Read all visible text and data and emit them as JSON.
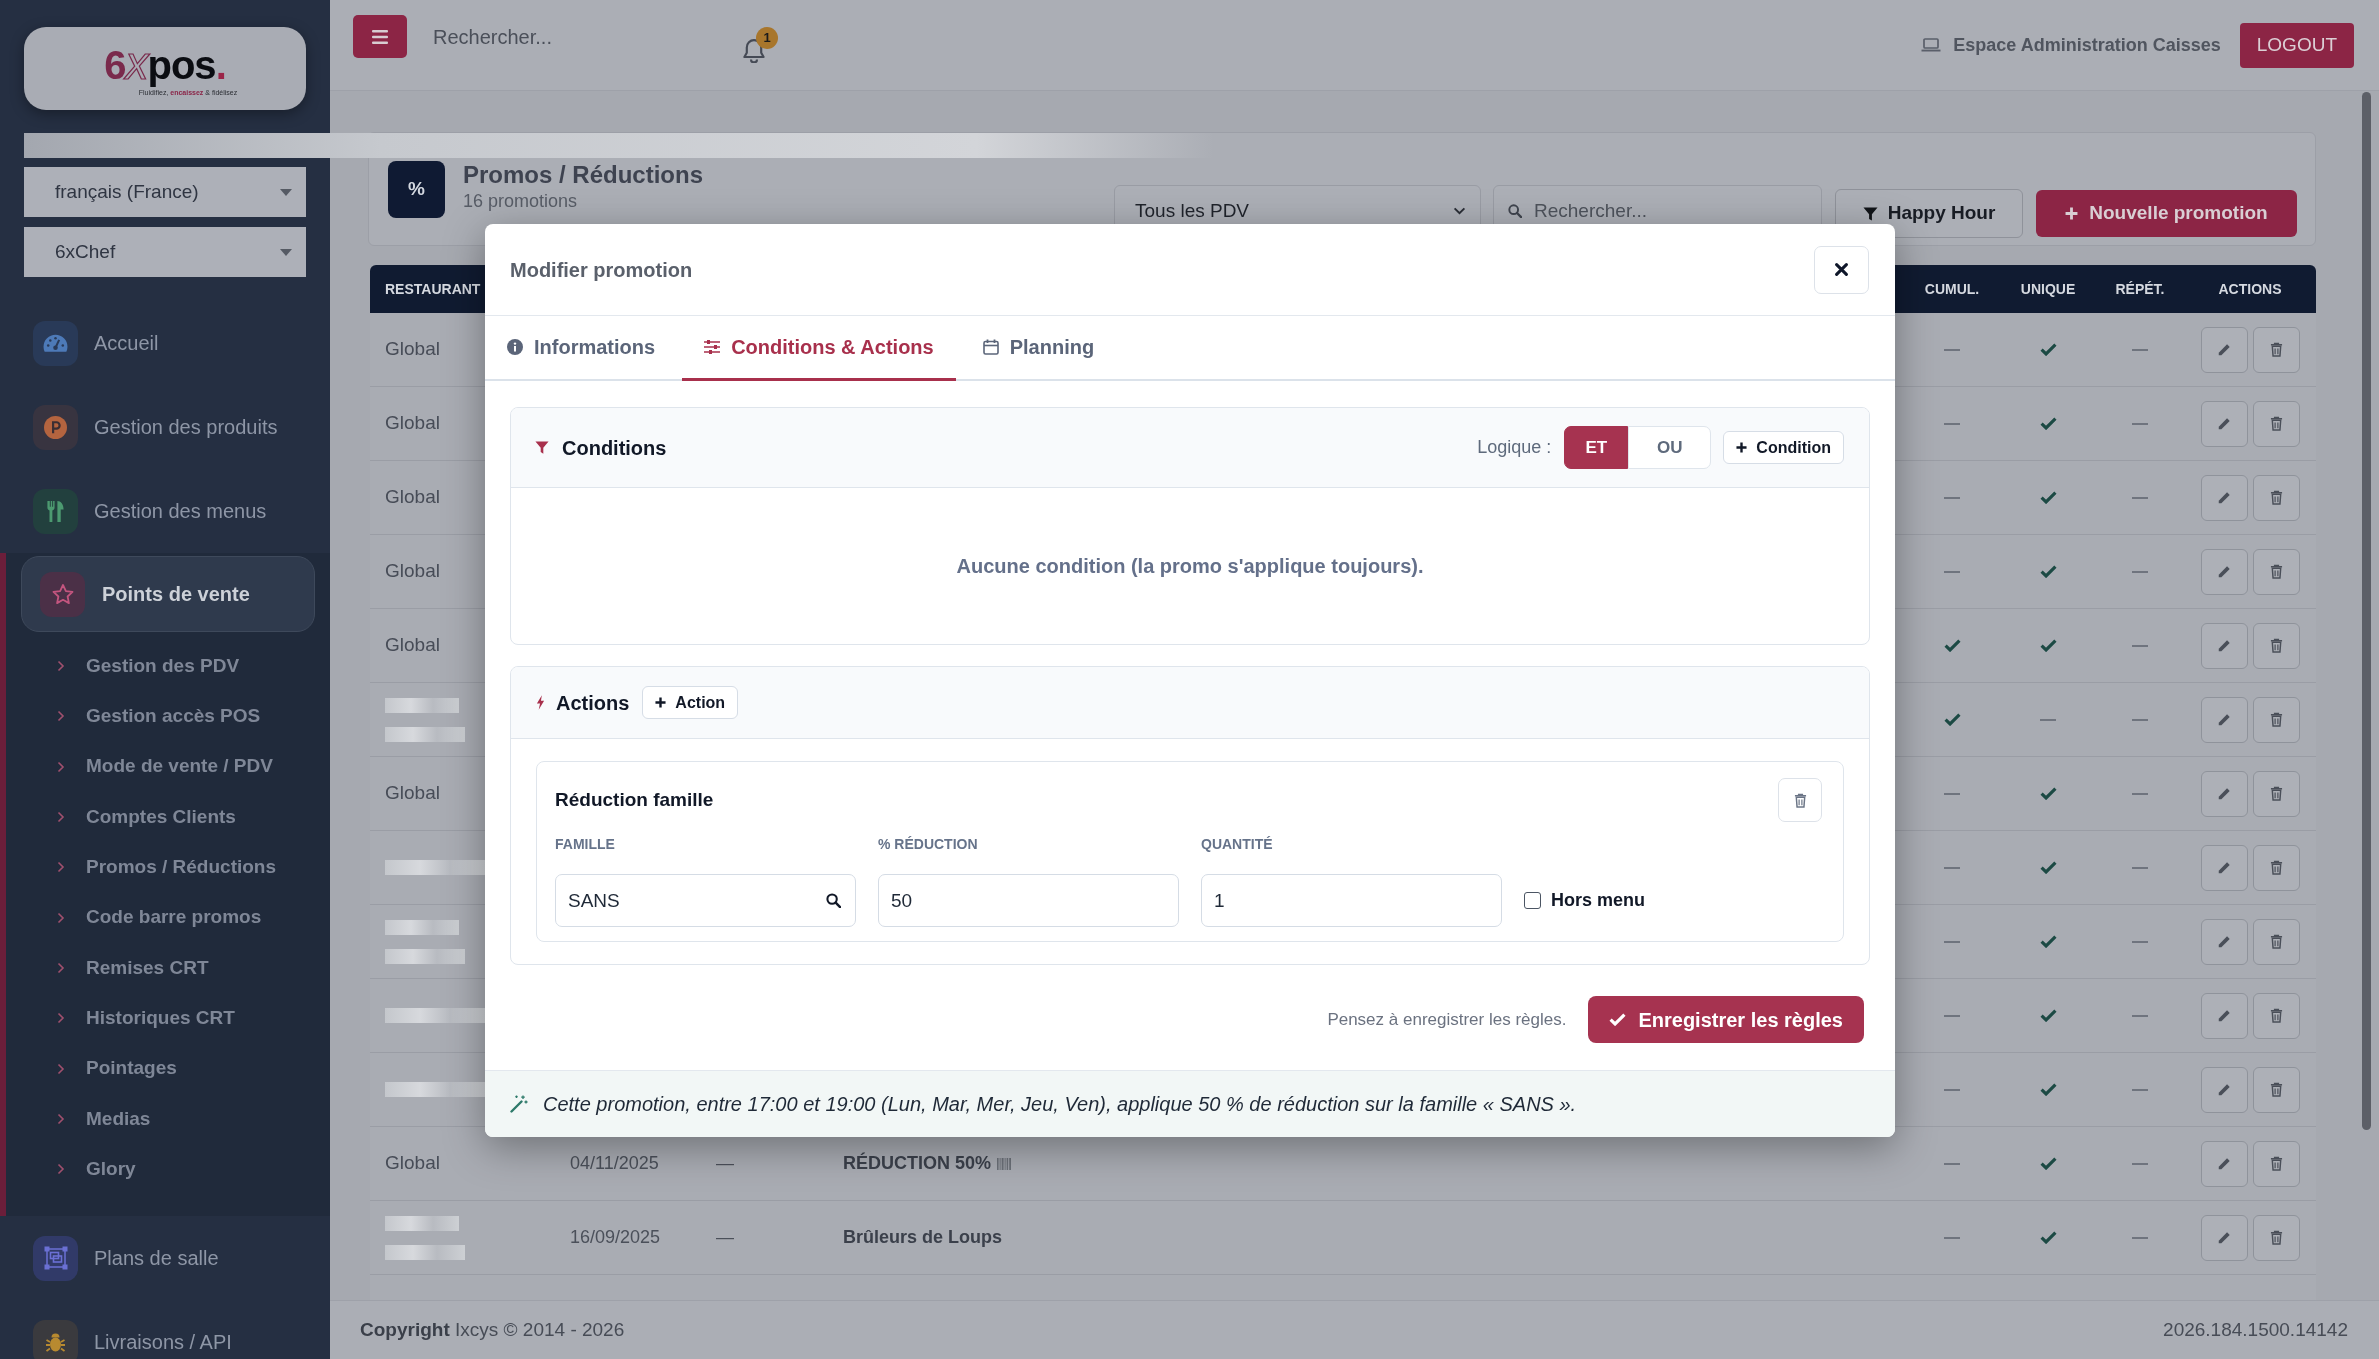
{
  "sidebar": {
    "logo": {
      "parts": [
        {
          "text": "6",
          "kind": "solid"
        },
        {
          "text": "x",
          "kind": "outline"
        },
        {
          "text": "pos",
          "kind": "plain"
        },
        {
          "text": ".",
          "kind": "accent"
        }
      ],
      "tagline": "Fluidifiez, **encaissez** & fidélisez"
    },
    "selects": [
      {
        "value": "français (France)"
      },
      {
        "value": "6xChef"
      }
    ],
    "items": [
      {
        "label": "Accueil",
        "selected": false
      },
      {
        "label": "Gestion des produits",
        "selected": false
      },
      {
        "label": "Gestion des menus",
        "selected": false
      },
      {
        "label": "Points de vente",
        "selected": true,
        "expanded": true,
        "children": [
          {
            "label": "Gestion des PDV",
            "selected": false
          },
          {
            "label": "Gestion accès POS",
            "selected": false
          },
          {
            "label": "Mode de vente / PDV",
            "selected": false
          },
          {
            "label": "Comptes Clients",
            "selected": false
          },
          {
            "label": "Promos / Réductions",
            "selected": false
          },
          {
            "label": "Code barre promos",
            "selected": false
          },
          {
            "label": "Remises CRT",
            "selected": false
          },
          {
            "label": "Historiques CRT",
            "selected": false
          },
          {
            "label": "Pointages",
            "selected": false
          },
          {
            "label": "Medias",
            "selected": false
          },
          {
            "label": "Glory",
            "selected": false
          }
        ]
      },
      {
        "label": "Plans de salle",
        "selected": false
      },
      {
        "label": "Livraisons / API",
        "selected": false
      }
    ]
  },
  "topbar": {
    "search": {
      "placeholder": "Rechercher..."
    },
    "notifications": {
      "count": "1"
    },
    "workspace": "Espace Administration Caisses",
    "logout": "LOGOUT"
  },
  "page_header": {
    "badge": "%",
    "title": "Promos / Réductions",
    "subtitle": "16 promotions",
    "pdv_select": {
      "value": "Tous les PDV"
    },
    "search": {
      "placeholder": "Rechercher..."
    },
    "buttons": [
      {
        "label": "Happy Hour",
        "kind": "filter"
      },
      {
        "label": "Nouvelle promotion",
        "kind": "add"
      }
    ]
  },
  "table": {
    "columns": [
      "RESTAURANT",
      "CUMUL.",
      "UNIQUE",
      "RÉPÉT.",
      "ACTIONS"
    ],
    "rows": [
      {
        "restaurant": {
          "kind": "text",
          "text": "Global"
        },
        "cumulative": false,
        "unique": true,
        "repeat": false
      },
      {
        "restaurant": {
          "kind": "text",
          "text": "Global"
        },
        "cumulative": false,
        "unique": true,
        "repeat": false
      },
      {
        "restaurant": {
          "kind": "text",
          "text": "Global"
        },
        "cumulative": false,
        "unique": true,
        "repeat": false
      },
      {
        "restaurant": {
          "kind": "text",
          "text": "Global"
        },
        "cumulative": false,
        "unique": true,
        "repeat": false
      },
      {
        "restaurant": {
          "kind": "text",
          "text": "Global"
        },
        "cumulative": true,
        "unique": true,
        "repeat": false
      },
      {
        "restaurant": {
          "kind": "redacted-double"
        },
        "cumulative": true,
        "unique": false,
        "repeat": false
      },
      {
        "restaurant": {
          "kind": "text",
          "text": "Global"
        },
        "cumulative": false,
        "unique": true,
        "repeat": false
      },
      {
        "restaurant": {
          "kind": "redacted"
        },
        "cumulative": false,
        "unique": true,
        "repeat": false
      },
      {
        "restaurant": {
          "kind": "redacted-double"
        },
        "cumulative": false,
        "unique": true,
        "repeat": false
      },
      {
        "restaurant": {
          "kind": "redacted"
        },
        "cumulative": false,
        "unique": true,
        "repeat": false
      },
      {
        "restaurant": {
          "kind": "redacted"
        },
        "cumulative": false,
        "unique": true,
        "repeat": false
      },
      {
        "restaurant": {
          "kind": "text",
          "text": "Global"
        },
        "column_2": "04/11/2025",
        "column_3": "—",
        "column_4": "RÉDUCTION 50%",
        "barcode": true,
        "cumulative": false,
        "unique": true,
        "repeat": false
      },
      {
        "restaurant": {
          "kind": "redacted-double"
        },
        "column_2": "16/09/2025",
        "column_3": "—",
        "column_4": "Brûleurs de Loups",
        "cumulative": false,
        "unique": true,
        "repeat": false
      }
    ]
  },
  "modal": {
    "title": "Modifier promotion",
    "tabs": [
      {
        "label": "Informations",
        "selected": false
      },
      {
        "label": "Conditions & Actions",
        "selected": true
      },
      {
        "label": "Planning",
        "selected": false
      }
    ],
    "conditions": {
      "title": "Conditions",
      "logic_label": "Logique :",
      "logic_options": [
        {
          "label": "ET",
          "selected": true
        },
        {
          "label": "OU",
          "selected": false
        }
      ],
      "add_button": "Condition",
      "empty_text": "Aucune condition (la promo s'applique toujours)."
    },
    "actions": {
      "title": "Actions",
      "add_button": "Action",
      "items": [
        {
          "title": "Réduction famille",
          "fields": [
            {
              "label": "FAMILLE",
              "value": "SANS",
              "kind": "search"
            },
            {
              "label": "% RÉDUCTION",
              "value": "50",
              "kind": "text"
            },
            {
              "label": "QUANTITÉ",
              "value": "1",
              "kind": "text"
            }
          ],
          "checkbox": {
            "label": "Hors menu",
            "checked": false
          }
        }
      ]
    },
    "save_hint": "Pensez à enregistrer les règles.",
    "save_button": "Enregistrer les règles",
    "summary": "Cette promotion, entre 17:00 et 19:00 (Lun, Mar, Mer, Jeu, Ven), applique 50 % de réduction sur la famille « SANS »."
  },
  "footer": {
    "copyright": "**Copyright** Ixcys © 2014 - 2026",
    "version": "2026.184.1500.14142"
  }
}
